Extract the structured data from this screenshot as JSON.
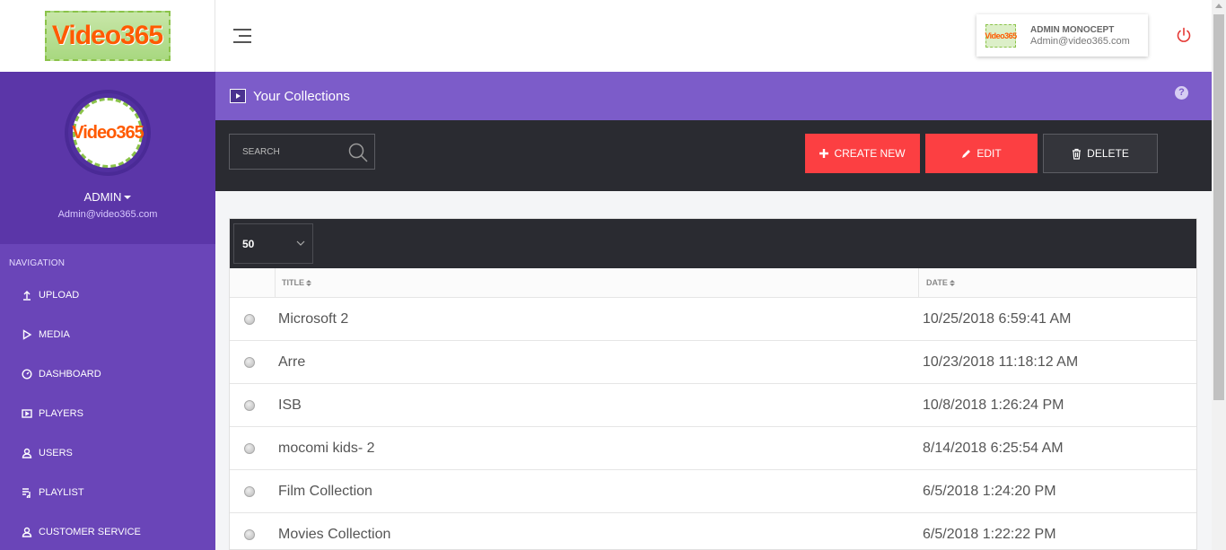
{
  "brand": {
    "logo_text": "Video365"
  },
  "profile": {
    "name": "ADMIN",
    "email": "Admin@video365.com"
  },
  "nav": {
    "heading": "NAVIGATION",
    "items": [
      {
        "label": "UPLOAD",
        "icon": "upload-icon"
      },
      {
        "label": "MEDIA",
        "icon": "play-icon"
      },
      {
        "label": "DASHBOARD",
        "icon": "gauge-icon"
      },
      {
        "label": "PLAYERS",
        "icon": "player-icon"
      },
      {
        "label": "USERS",
        "icon": "user-icon"
      },
      {
        "label": "PLAYLIST",
        "icon": "playlist-icon"
      },
      {
        "label": "CUSTOMER SERVICE",
        "icon": "user-icon"
      }
    ]
  },
  "topbar": {
    "user_name": "ADMIN MONOCEPT",
    "user_email": "Admin@video365.com",
    "power_color": "#e53935"
  },
  "page": {
    "title": "Your Collections",
    "help_label": "?"
  },
  "toolbar": {
    "search_placeholder": "SEARCH",
    "create_label": "CREATE NEW",
    "edit_label": "EDIT",
    "delete_label": "DELETE",
    "accent_color": "#fc3f42"
  },
  "table": {
    "page_size": "50",
    "columns": {
      "title": "TITLE",
      "date": "DATE"
    },
    "rows": [
      {
        "title": "Microsoft 2",
        "date": "10/25/2018 6:59:41 AM"
      },
      {
        "title": "Arre",
        "date": "10/23/2018 11:18:12 AM"
      },
      {
        "title": "ISB",
        "date": "10/8/2018 1:26:24 PM"
      },
      {
        "title": "mocomi kids- 2",
        "date": "8/14/2018 6:25:54 AM"
      },
      {
        "title": "Film Collection",
        "date": "6/5/2018 1:24:20 PM"
      },
      {
        "title": "Movies Collection",
        "date": "6/5/2018 1:22:22 PM"
      }
    ]
  }
}
